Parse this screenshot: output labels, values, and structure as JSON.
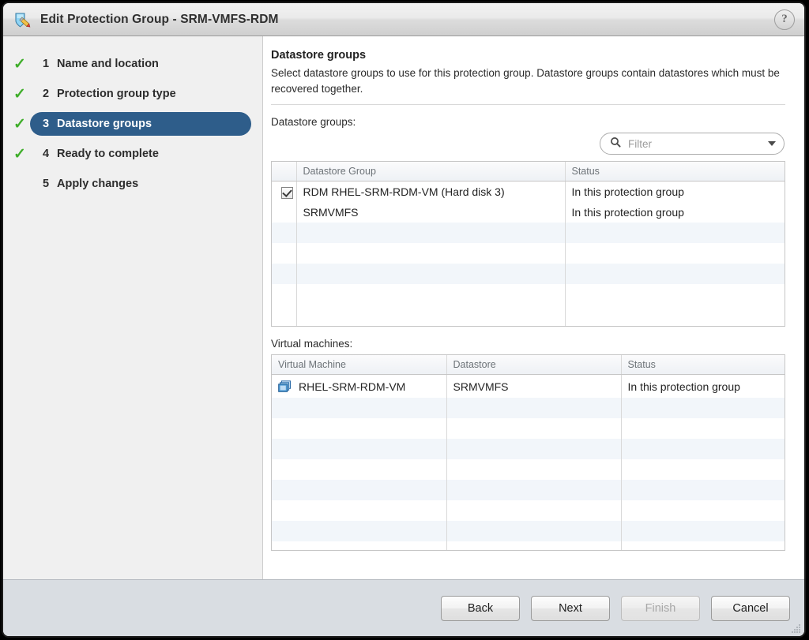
{
  "window": {
    "title": "Edit Protection Group - SRM-VMFS-RDM",
    "title_icon": "shield-pencil-icon",
    "help_label": "?"
  },
  "sidebar": {
    "steps": [
      {
        "num": "1",
        "label": "Name and location",
        "done": true,
        "active": false,
        "check": "✓"
      },
      {
        "num": "2",
        "label": "Protection group type",
        "done": true,
        "active": false,
        "check": "✓"
      },
      {
        "num": "3",
        "label": "Datastore groups",
        "done": true,
        "active": true,
        "check": "✓"
      },
      {
        "num": "4",
        "label": "Ready to complete",
        "done": true,
        "active": false,
        "check": "✓"
      },
      {
        "num": "5",
        "label": "Apply changes",
        "done": false,
        "active": false,
        "check": ""
      }
    ]
  },
  "main": {
    "title": "Datastore groups",
    "description": "Select datastore groups to use for this protection group. Datastore groups contain datastores which must be recovered together.",
    "datastore_groups_label": "Datastore groups:",
    "virtual_machines_label": "Virtual machines:",
    "filter": {
      "placeholder": "Filter",
      "value": "",
      "icon": "search-icon",
      "dropdown_icon": "chevron-down-icon"
    },
    "datastore_table": {
      "columns": [
        "",
        "Datastore Group",
        "Status"
      ],
      "rows": [
        {
          "checked": true,
          "has_checkbox": true,
          "name": "RDM RHEL-SRM-RDM-VM (Hard disk 3)",
          "status": "In this protection group",
          "stripe": false
        },
        {
          "checked": false,
          "has_checkbox": false,
          "name": "SRMVMFS",
          "status": "In this protection group",
          "stripe": false
        }
      ],
      "empty_rows": 5
    },
    "vm_table": {
      "columns": [
        "Virtual Machine",
        "Datastore",
        "Status"
      ],
      "rows": [
        {
          "icon": "virtual-machine-icon",
          "name": "RHEL-SRM-RDM-VM",
          "datastore": "SRMVMFS",
          "status": "In this protection group",
          "stripe": false
        }
      ],
      "empty_rows": 7
    }
  },
  "footer": {
    "buttons": [
      {
        "label": "Back",
        "disabled": false
      },
      {
        "label": "Next",
        "disabled": false
      },
      {
        "label": "Finish",
        "disabled": true
      },
      {
        "label": "Cancel",
        "disabled": false
      }
    ]
  },
  "colors": {
    "accent_blue": "#2e5d8a",
    "check_green": "#3fae2a",
    "stripe": "#f2f6fa",
    "footer_bg": "#d9dde2",
    "sidebar_bg": "#f0f0f0"
  }
}
